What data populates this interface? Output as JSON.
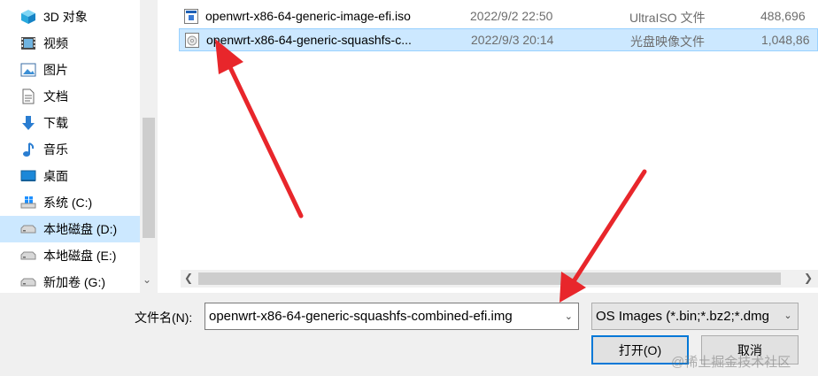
{
  "sidebar": {
    "items": [
      {
        "label": "3D 对象",
        "icon": "cube-3d-icon"
      },
      {
        "label": "视频",
        "icon": "video-icon"
      },
      {
        "label": "图片",
        "icon": "picture-icon"
      },
      {
        "label": "文档",
        "icon": "document-icon"
      },
      {
        "label": "下载",
        "icon": "download-icon"
      },
      {
        "label": "音乐",
        "icon": "music-icon"
      },
      {
        "label": "桌面",
        "icon": "desktop-icon"
      },
      {
        "label": "系统 (C:)",
        "icon": "windows-drive-icon"
      },
      {
        "label": "本地磁盘 (D:)",
        "icon": "drive-icon"
      },
      {
        "label": "本地磁盘 (E:)",
        "icon": "drive-icon"
      },
      {
        "label": "新加卷 (G:)",
        "icon": "drive-icon"
      }
    ]
  },
  "files": [
    {
      "name": "openwrt-x86-64-generic-image-efi.iso",
      "date": "2022/9/2 22:50",
      "type": "UltraISO 文件",
      "size": "488,696",
      "icon": "iso-file-icon"
    },
    {
      "name": "openwrt-x86-64-generic-squashfs-c...",
      "date": "2022/9/3 20:14",
      "type": "光盘映像文件",
      "size": "1,048,86",
      "icon": "disc-image-icon"
    }
  ],
  "footer": {
    "filename_label": "文件名(N):",
    "filename_value": "openwrt-x86-64-generic-squashfs-combined-efi.img",
    "filetype_value": "OS Images (*.bin;*.bz2;*.dmg",
    "open_label": "打开(O)",
    "cancel_label": "取消"
  },
  "watermark": "@稀土掘金技术社区",
  "colors": {
    "selection": "#cce8ff",
    "arrow": "#e8262b",
    "accent": "#0078d7"
  }
}
